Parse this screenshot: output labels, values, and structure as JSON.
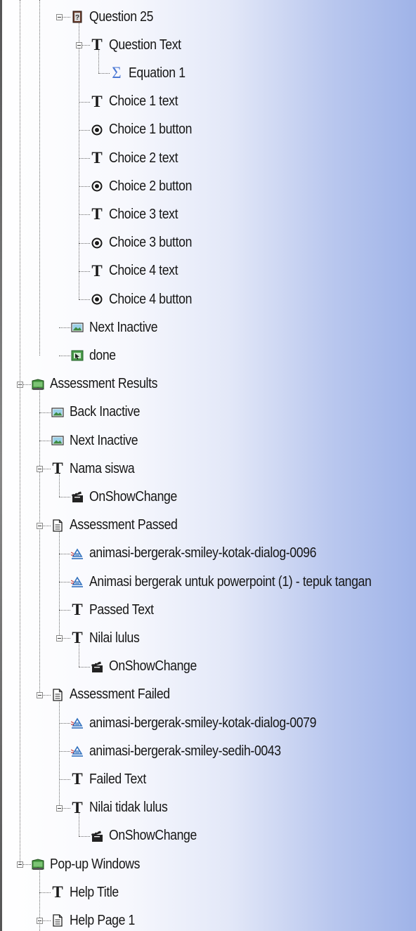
{
  "tree": {
    "nodes": [
      {
        "id": "question-25",
        "label": "Question 25",
        "icon": "question-page-icon",
        "depth": 3,
        "expandable": true
      },
      {
        "id": "question-text",
        "label": "Question Text",
        "icon": "text-icon",
        "depth": 4,
        "expandable": true
      },
      {
        "id": "equation-1",
        "label": "Equation 1",
        "icon": "equation-icon",
        "depth": 5,
        "expandable": false
      },
      {
        "id": "choice-1-text",
        "label": "Choice 1 text",
        "icon": "text-icon",
        "depth": 4,
        "expandable": false
      },
      {
        "id": "choice-1-button",
        "label": "Choice 1 button",
        "icon": "radio-button-icon",
        "depth": 4,
        "expandable": false
      },
      {
        "id": "choice-2-text",
        "label": "Choice 2 text",
        "icon": "text-icon",
        "depth": 4,
        "expandable": false
      },
      {
        "id": "choice-2-button",
        "label": "Choice 2 button",
        "icon": "radio-button-icon",
        "depth": 4,
        "expandable": false
      },
      {
        "id": "choice-3-text",
        "label": "Choice 3 text",
        "icon": "text-icon",
        "depth": 4,
        "expandable": false
      },
      {
        "id": "choice-3-button",
        "label": "Choice 3 button",
        "icon": "radio-button-icon",
        "depth": 4,
        "expandable": false
      },
      {
        "id": "choice-4-text",
        "label": "Choice 4 text",
        "icon": "text-icon",
        "depth": 4,
        "expandable": false
      },
      {
        "id": "choice-4-button",
        "label": "Choice 4 button",
        "icon": "radio-button-icon",
        "depth": 4,
        "expandable": false
      },
      {
        "id": "next-inactive-1",
        "label": "Next Inactive",
        "icon": "image-icon",
        "depth": 3,
        "expandable": false
      },
      {
        "id": "done",
        "label": "done",
        "icon": "done-button-icon",
        "depth": 3,
        "expandable": false
      },
      {
        "id": "assessment-results",
        "label": "Assessment Results",
        "icon": "chapter-book-icon",
        "depth": 1,
        "expandable": true
      },
      {
        "id": "back-inactive",
        "label": "Back Inactive",
        "icon": "image-icon",
        "depth": 2,
        "expandable": false
      },
      {
        "id": "next-inactive-2",
        "label": "Next Inactive",
        "icon": "image-icon",
        "depth": 2,
        "expandable": false
      },
      {
        "id": "nama-siswa",
        "label": "Nama siswa",
        "icon": "text-icon",
        "depth": 2,
        "expandable": true
      },
      {
        "id": "onshowchange-1",
        "label": "OnShowChange",
        "icon": "clapperboard-icon",
        "depth": 3,
        "expandable": false
      },
      {
        "id": "assessment-passed",
        "label": "Assessment Passed",
        "icon": "page-icon",
        "depth": 2,
        "expandable": true
      },
      {
        "id": "anim-smiley-kotak-0096",
        "label": "animasi-bergerak-smiley-kotak-dialog-0096",
        "icon": "animation-icon",
        "depth": 3,
        "expandable": false
      },
      {
        "id": "anim-tepuk-tangan",
        "label": "Animasi bergerak untuk powerpoint (1) - tepuk tangan",
        "icon": "animation-icon",
        "depth": 3,
        "expandable": false
      },
      {
        "id": "passed-text",
        "label": "Passed Text",
        "icon": "text-icon",
        "depth": 3,
        "expandable": false
      },
      {
        "id": "nilai-lulus",
        "label": "Nilai lulus",
        "icon": "text-icon",
        "depth": 3,
        "expandable": true
      },
      {
        "id": "onshowchange-2",
        "label": "OnShowChange",
        "icon": "clapperboard-icon",
        "depth": 4,
        "expandable": false
      },
      {
        "id": "assessment-failed",
        "label": "Assessment Failed",
        "icon": "page-icon",
        "depth": 2,
        "expandable": true
      },
      {
        "id": "anim-smiley-kotak-0079",
        "label": "animasi-bergerak-smiley-kotak-dialog-0079",
        "icon": "animation-icon",
        "depth": 3,
        "expandable": false
      },
      {
        "id": "anim-smiley-sedih-0043",
        "label": "animasi-bergerak-smiley-sedih-0043",
        "icon": "animation-icon",
        "depth": 3,
        "expandable": false
      },
      {
        "id": "failed-text",
        "label": "Failed Text",
        "icon": "text-icon",
        "depth": 3,
        "expandable": false
      },
      {
        "id": "nilai-tidak-lulus",
        "label": "Nilai tidak lulus",
        "icon": "text-icon",
        "depth": 3,
        "expandable": true
      },
      {
        "id": "onshowchange-3",
        "label": "OnShowChange",
        "icon": "clapperboard-icon",
        "depth": 4,
        "expandable": false
      },
      {
        "id": "popup-windows",
        "label": "Pop-up Windows",
        "icon": "chapter-book-icon",
        "depth": 1,
        "expandable": true
      },
      {
        "id": "help-title",
        "label": "Help Title",
        "icon": "text-icon",
        "depth": 2,
        "expandable": false
      },
      {
        "id": "help-page-1",
        "label": "Help Page 1",
        "icon": "page-icon",
        "depth": 2,
        "expandable": true
      }
    ]
  },
  "colors": {
    "background_left": "#ffffff",
    "background_right": "#9fb3e8",
    "text": "#161616",
    "tree_lines": "#6d6d6d",
    "chapter_icon": "#3f8f3a",
    "equation_icon": "#4b78d4",
    "animation_icon": "#2f6fbd",
    "question_icon": "#6b3a2a"
  }
}
